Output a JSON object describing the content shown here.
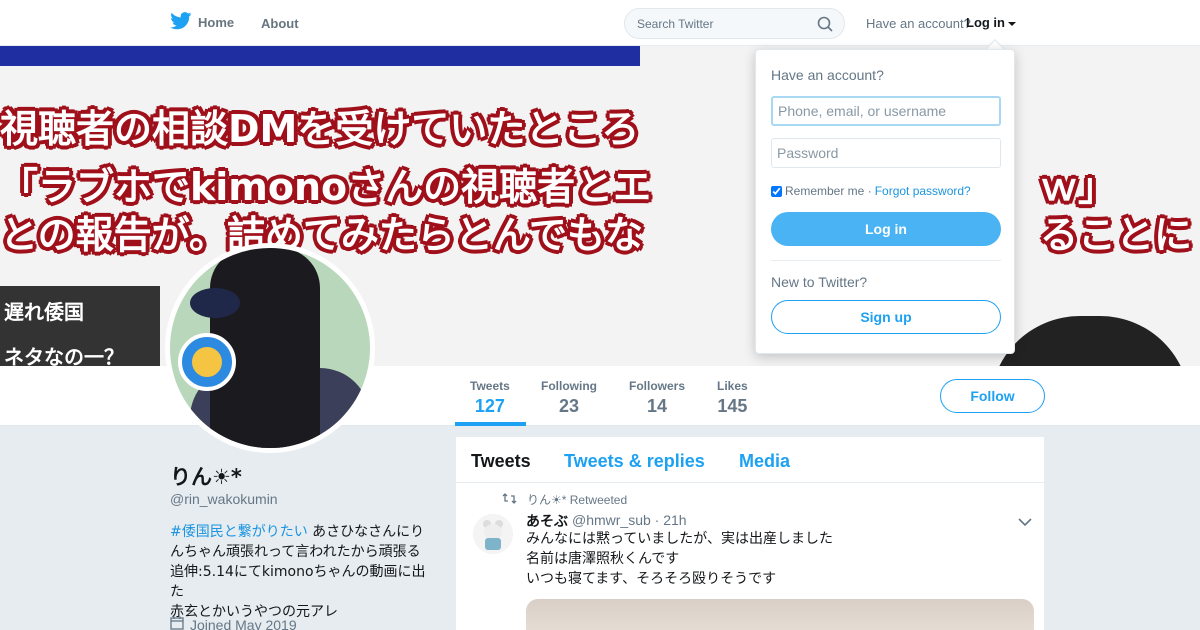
{
  "nav": {
    "home_label": "Home",
    "about_label": "About",
    "search_placeholder": "Search Twitter",
    "have_account": "Have an account?",
    "login_label": "Log in"
  },
  "banner": {
    "line1": "視聴者の相談DMを受けていたところ",
    "line2": "「ラブホでkimonoさんの視聴者とエ",
    "line2b": "ｗ」",
    "line3": "との報告が。詰めてみたらとんでもな",
    "line3b": "ることに",
    "side1": "遅れ倭国",
    "side2": "ネタなの一？"
  },
  "profile": {
    "name": "りん☀*",
    "handle": "@rin_wakokumin",
    "bio_hashtag": "#倭国民と繋がりたい",
    "bio_line1_rest": " あさひなさんにり",
    "bio_line2": "んちゃん頑張れって言われたから頑張る",
    "bio_line3": "追伸:5.14にてkimonoちゃんの動画に出た",
    "bio_line4": "赤玄とかいうやつの元アレ",
    "joined": "Joined May 2019"
  },
  "stats": [
    {
      "label": "Tweets",
      "value": "127"
    },
    {
      "label": "Following",
      "value": "23"
    },
    {
      "label": "Followers",
      "value": "14"
    },
    {
      "label": "Likes",
      "value": "145"
    }
  ],
  "follow_label": "Follow",
  "timeline": {
    "tabs": [
      "Tweets",
      "Tweets & replies",
      "Media"
    ],
    "tweet": {
      "retweeted_by": "りん☀* Retweeted",
      "author_name": "あそぶ",
      "author_handle": "@hmwr_sub · 21h",
      "lines": [
        "みんなには黙っていましたが、実は出産しました",
        "名前は唐澤照秋くんです",
        "いつも寝てます、そろそろ殴りそうです"
      ]
    }
  },
  "login_dropdown": {
    "title": "Have an account?",
    "username_placeholder": "Phone, email, or username",
    "password_placeholder": "Password",
    "remember_me": "Remember me ·",
    "forgot_password": "Forgot password?",
    "login_button": "Log in",
    "new_to_twitter": "New to Twitter?",
    "signup_button": "Sign up"
  },
  "colors": {
    "accent": "#1da1f2",
    "login_button_bg": "#4ab3f4",
    "page_bg": "#e6ecf0"
  }
}
